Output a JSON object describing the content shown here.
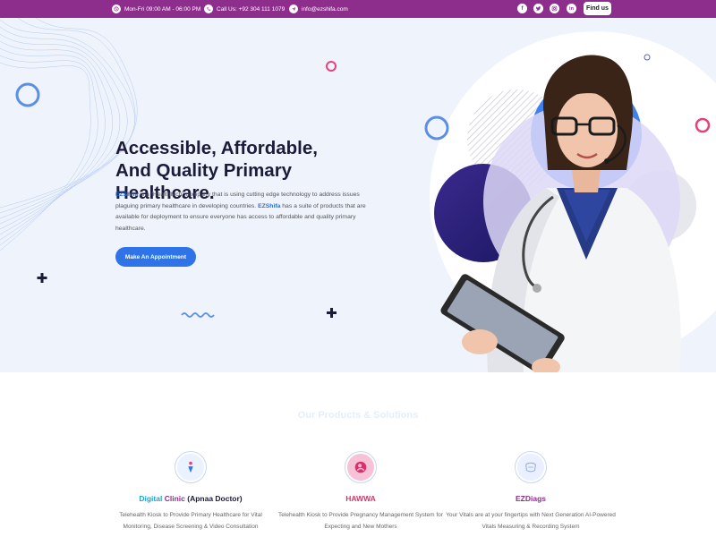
{
  "topbar": {
    "hours": "Mon-Fri 09:00 AM - 06:00 PM",
    "phone": "Call Us: +92 304 111 1079",
    "email": "info@ezshifa.com",
    "socials": [
      "f",
      "t",
      "ig",
      "in"
    ],
    "find_us": "Find us",
    "bg_color": "#8e2e8c"
  },
  "hero": {
    "title_line1": "Accessible, Affordable,",
    "title_line2": "And Quality Primary",
    "title_line3": "Healthcare.",
    "desc_brand1": "EZShifa",
    "desc_part1": " is a “Healthtech” company that is using cutting edge technology to address issues plaguing primary healthcare in developing countries. ",
    "desc_brand2": "EZShifa",
    "desc_part2": " has a suite of products that are available for deployment to ensure everyone has access to affordable and quality primary healthcare.",
    "cta": "Make An Appointment"
  },
  "products": {
    "section_title": "Our Products & Solutions",
    "items": [
      {
        "title_a": "Digital",
        "title_b": "Clinic",
        "title_c": "(Apnaa Doctor)",
        "desc": "Telehealth Kiosk to Provide Primary Healthcare for Vital Monitoring, Disease Screening & Video Consultation",
        "icon": "clinic-icon"
      },
      {
        "title": "HAWWA",
        "desc": "Telehealth Kiosk to Provide Pregnancy Management System for Expecting and New Mothers",
        "icon": "mother-icon"
      },
      {
        "title": "EZDiags",
        "desc": "Your Vitals are at your fingertips with Next Generation AI-Powered Vitals Measuring & Recording System",
        "icon": "diagnostics-icon"
      }
    ]
  },
  "colors": {
    "accent": "#2e73e8",
    "pink": "#e8407a",
    "navy": "#1c1b3a",
    "purple": "#8e2e8c"
  }
}
